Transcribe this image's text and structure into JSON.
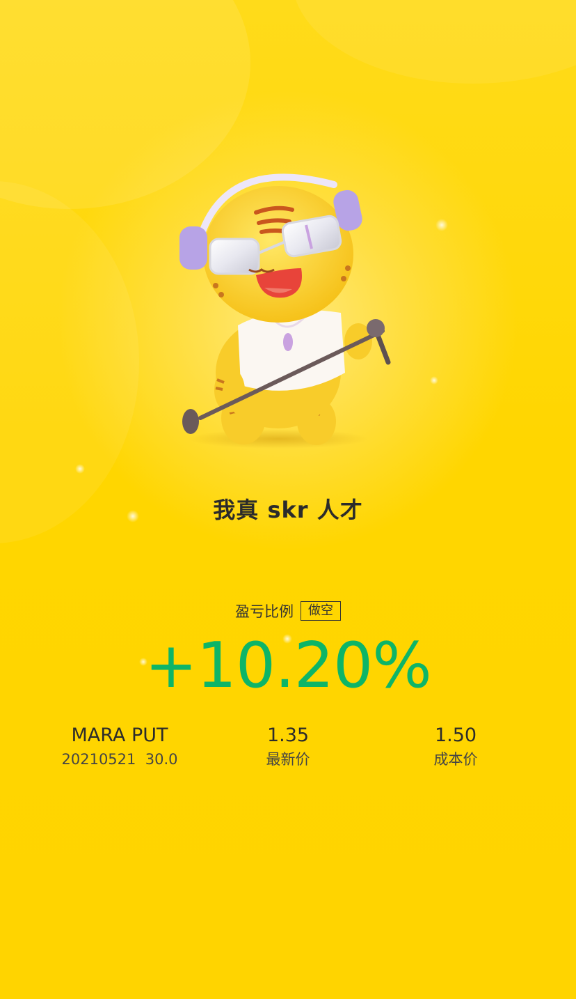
{
  "result": {
    "slogan": "我真 skr 人才"
  },
  "profit_loss": {
    "label": "盈亏比例",
    "direction": "做空",
    "value": "+10.20%",
    "value_color": "#0DB567"
  },
  "position": {
    "symbol": "MARA PUT",
    "contract": "20210521  30.0"
  },
  "prices": {
    "latest_value": "1.35",
    "latest_label": "最新价",
    "cost_value": "1.50",
    "cost_label": "成本价"
  },
  "colors": {
    "background": "#FFD400",
    "text": "#2B2B2B"
  },
  "icons": {
    "mascot": "tiger-mascot-singing-icon"
  }
}
